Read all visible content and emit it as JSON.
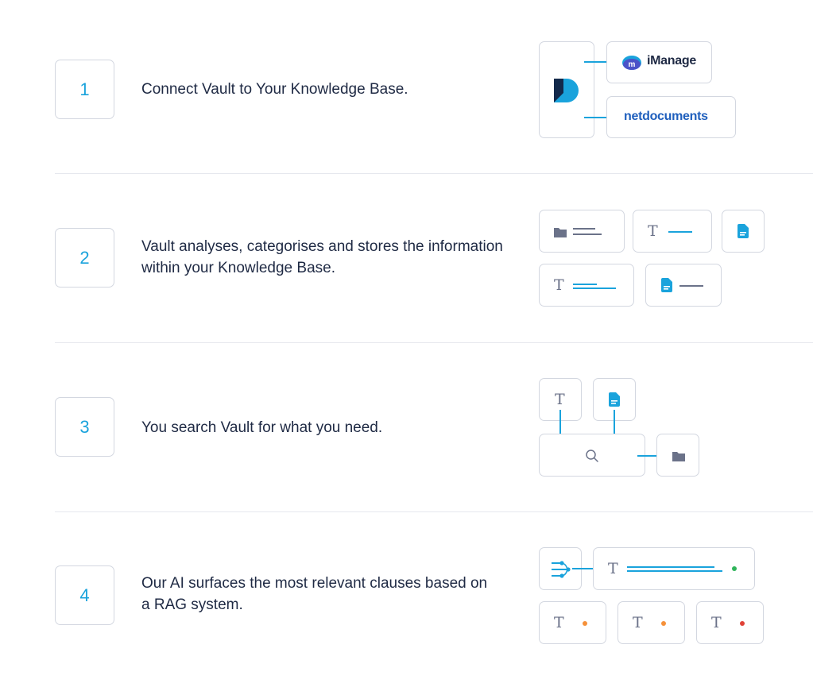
{
  "steps": [
    {
      "number": "1",
      "text": "Connect Vault to Your Knowledge Base."
    },
    {
      "number": "2",
      "text": "Vault analyses, categorises and stores the information within your Knowledge Base."
    },
    {
      "number": "3",
      "text": "You search Vault for what you need."
    },
    {
      "number": "4",
      "text": "Our AI surfaces the most relevant clauses based on a RAG system."
    }
  ],
  "integrations": {
    "imanage": "iManage",
    "netdocuments": "netdocuments"
  },
  "glyphs": {
    "text_type": "T"
  },
  "colors": {
    "accent": "#1aa3dc",
    "border": "#d3d7e0",
    "text": "#1f2a44",
    "muted": "#6b7289",
    "dot_green": "#2fb45a",
    "dot_orange": "#f5913a",
    "dot_red": "#e04237"
  },
  "icons": [
    "vault-logo-icon",
    "imanage-logo-icon",
    "folder-icon",
    "document-icon",
    "search-icon",
    "ai-flow-icon"
  ]
}
